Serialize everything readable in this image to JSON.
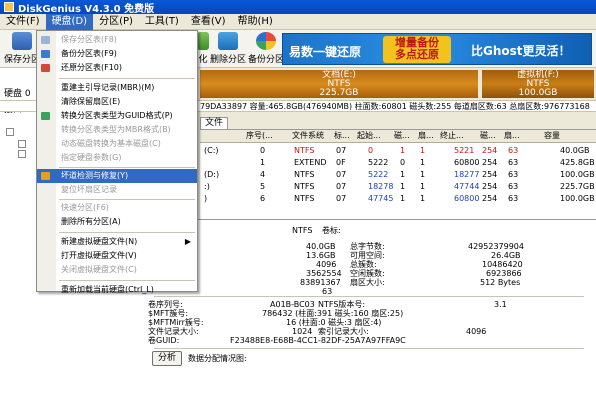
{
  "window": {
    "title": "DiskGenius V4.3.0 免费版"
  },
  "menubar": [
    {
      "label": "文件(F)"
    },
    {
      "label": "硬盘(D)"
    },
    {
      "label": "分区(P)"
    },
    {
      "label": "工具(T)"
    },
    {
      "label": "查看(V)"
    },
    {
      "label": "帮助(H)"
    }
  ],
  "toolbar": {
    "save_label": "保存分区",
    "partition_label": "化",
    "delete_label": "删除分区",
    "backup_label": "备份分区",
    "banner": {
      "text1": "易数一键还原",
      "text2_line1": "增量备份",
      "text2_line2": "多点还原",
      "text3": "比Ghost更灵活！"
    }
  },
  "left": {
    "disk_label": "硬盘 0",
    "port_label": "接口:A"
  },
  "diskmap": [
    {
      "name": "文档(E:)",
      "fs": "NTFS",
      "size": "225.7GB",
      "color": "#c57a15"
    },
    {
      "name": "虚拟机(F:)",
      "fs": "NTFS",
      "size": "100.0GB",
      "color": "#b16c10"
    }
  ],
  "inforow": "79DA33897  容量:465.8GB(476940MB)  柱面数:60801  磁头数:255  每道扇区数:63  总扇区数:976773168",
  "tabs": {
    "label": "文件"
  },
  "table": {
    "headers": [
      "序号(...",
      "文件系统",
      "标...",
      "起始...",
      "磁...",
      "扇...",
      "终止...",
      "磁...",
      "扇...",
      "容量"
    ],
    "rows": [
      {
        "name": "(C:)",
        "seq": "0",
        "fs": "NTFS",
        "id": "07",
        "start_cyl": "0",
        "start_head": "1",
        "start_sec": "1",
        "end_cyl": "5221",
        "end_head": "254",
        "end_sec": "63",
        "size": "40.0GB",
        "style": "red"
      },
      {
        "name": "",
        "seq": "1",
        "fs": "EXTEND",
        "id": "0F",
        "start_cyl": "5222",
        "start_head": "0",
        "start_sec": "1",
        "end_cyl": "60800",
        "end_head": "254",
        "end_sec": "63",
        "size": "425.8GB",
        "style": "normal"
      },
      {
        "name": "(D:)",
        "seq": "4",
        "fs": "NTFS",
        "id": "07",
        "start_cyl": "5222",
        "start_head": "1",
        "start_sec": "1",
        "end_cyl": "18277",
        "end_head": "254",
        "end_sec": "63",
        "size": "100.0GB",
        "style": "blue"
      },
      {
        "name": ":)",
        "seq": "5",
        "fs": "NTFS",
        "id": "07",
        "start_cyl": "18278",
        "start_head": "1",
        "start_sec": "1",
        "end_cyl": "47744",
        "end_head": "254",
        "end_sec": "63",
        "size": "225.7GB",
        "style": "blue"
      },
      {
        "name": ")",
        "seq": "6",
        "fs": "NTFS",
        "id": "07",
        "start_cyl": "47745",
        "start_head": "1",
        "start_sec": "1",
        "end_cyl": "60800",
        "end_head": "254",
        "end_sec": "63",
        "size": "100.0GB",
        "style": "blue"
      }
    ]
  },
  "details": {
    "fs_type": "NTFS",
    "volume_label_key": "卷标:",
    "left_values": [
      "40.0GB",
      "13.6GB",
      "4096",
      "3562554",
      "83891367",
      "63"
    ],
    "right_keys": [
      "总字节数:",
      "可用空间:",
      "总簇数:",
      "空闲簇数:",
      "扇区大小:"
    ],
    "right_values": [
      "42952379904",
      "26.4GB",
      "10486420",
      "6923866",
      "512 Bytes"
    ],
    "serial_key": "卷序列号:",
    "serial_value": "A01B-BC03",
    "ntfs_ver_key": "NTFS版本号:",
    "ntfs_ver_value": "3.1",
    "mft_key": "$MFT簇号:",
    "mft_value": "786432 (柱面:391 磁头:160 扇区:25)",
    "mftmirr_key": "$MFTMirr簇号:",
    "mftmirr_value": "16 (柱面:0 磁头:3 扇区:4)",
    "record_key": "文件记录大小:",
    "record_value": "1024",
    "index_key": "索引记录大小:",
    "index_value": "4096",
    "guid_key": "卷GUID:",
    "guid_value": "F23488E8-E68B-4CC1-82DF-25A7A97FFA9C",
    "analyze_button": "分析",
    "analyze_label": "数据分配情况图:"
  },
  "dropdown": [
    {
      "label": "保存分区表(F8)",
      "disabled": true,
      "icon": "save-icon"
    },
    {
      "label": "备份分区表(F9)",
      "disabled": false,
      "icon": "backup-icon"
    },
    {
      "label": "还原分区表(F10)",
      "disabled": false,
      "icon": "restore-icon"
    },
    {
      "label": "重建主引导记录(MBR)(M)",
      "disabled": false
    },
    {
      "label": "清除保留扇区(E)",
      "disabled": false
    },
    {
      "label": "转换分区表类型为GUID格式(P)",
      "disabled": false,
      "icon": "convert-icon"
    },
    {
      "label": "转换分区表类型为MBR格式(B)",
      "disabled": true
    },
    {
      "label": "动态磁盘转换为基本磁盘(C)",
      "disabled": true
    },
    {
      "label": "指定硬盘参数(G)",
      "disabled": true
    },
    {
      "label": "坏道检测与修复(Y)",
      "disabled": false,
      "hover": true,
      "icon": "repair-icon"
    },
    {
      "label": "复位坏扇区记录",
      "disabled": true
    },
    {
      "label": "快速分区(F6)",
      "disabled": true
    },
    {
      "label": "删除所有分区(A)",
      "disabled": false
    },
    {
      "label": "新建虚拟硬盘文件(N)",
      "disabled": false,
      "submenu": true
    },
    {
      "label": "打开虚拟硬盘文件(V)",
      "disabled": false
    },
    {
      "label": "关闭虚拟硬盘文件(C)",
      "disabled": true
    },
    {
      "label": "重新加载当前硬盘(Ctrl_L)",
      "disabled": false
    }
  ]
}
